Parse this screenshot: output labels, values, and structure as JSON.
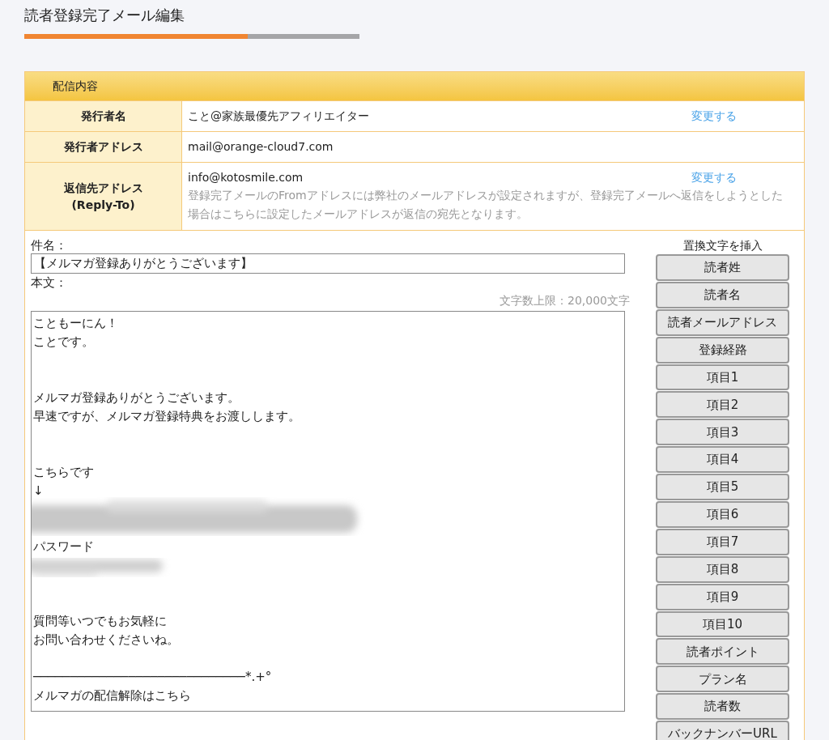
{
  "page": {
    "title": "読者登録完了メール編集"
  },
  "panel": {
    "header": "配信内容",
    "rows": [
      {
        "label": "発行者名",
        "value": "こと@家族最優先アフィリエイター",
        "link": "変更する"
      },
      {
        "label": "発行者アドレス",
        "value": "mail@orange-cloud7.com"
      },
      {
        "label": "返信先アドレス",
        "label_sub": "(Reply-To)",
        "value": "info@kotosmile.com",
        "link": "変更する",
        "note": "登録完了メールのFromアドレスには弊社のメールアドレスが設定されますが、登録完了メールへ返信をしようとした場合はこちらに設定したメールアドレスが返信の宛先となります。"
      }
    ]
  },
  "editor": {
    "subject_label": "件名：",
    "subject": "【メルマガ登録ありがとうございます】",
    "body_label": "本文：",
    "limit": "文字数上限：20,000文字",
    "body_lines": [
      {
        "kind": "text",
        "text": "こともーにん！"
      },
      {
        "kind": "text",
        "text": "ことです。"
      },
      {
        "kind": "blank"
      },
      {
        "kind": "blank"
      },
      {
        "kind": "text",
        "text": "メルマガ登録ありがとうございます。"
      },
      {
        "kind": "text",
        "text": "早速ですが、メルマガ登録特典をお渡しします。"
      },
      {
        "kind": "blank"
      },
      {
        "kind": "blank"
      },
      {
        "kind": "text",
        "text": "こちらです"
      },
      {
        "kind": "text",
        "text": "↓"
      },
      {
        "kind": "redacted"
      },
      {
        "kind": "blank"
      },
      {
        "kind": "text",
        "text": "パスワード"
      },
      {
        "kind": "redacted"
      },
      {
        "kind": "blank"
      },
      {
        "kind": "blank"
      },
      {
        "kind": "text",
        "text": "質問等いつでもお気軽に"
      },
      {
        "kind": "text",
        "text": "お問い合わせくださいね。"
      },
      {
        "kind": "blank"
      },
      {
        "kind": "text",
        "text": "─────────────────────────────*.+°"
      },
      {
        "kind": "text",
        "text": "メルマガの配信解除はこちら"
      }
    ]
  },
  "insert": {
    "title": "置換文字を挿入",
    "buttons": [
      "読者姓",
      "読者名",
      "読者メールアドレス",
      "登録経路",
      "項目1",
      "項目2",
      "項目3",
      "項目4",
      "項目5",
      "項目6",
      "項目7",
      "項目8",
      "項目9",
      "項目10",
      "読者ポイント",
      "プラン名",
      "読者数",
      "バックナンバーURL"
    ]
  }
}
